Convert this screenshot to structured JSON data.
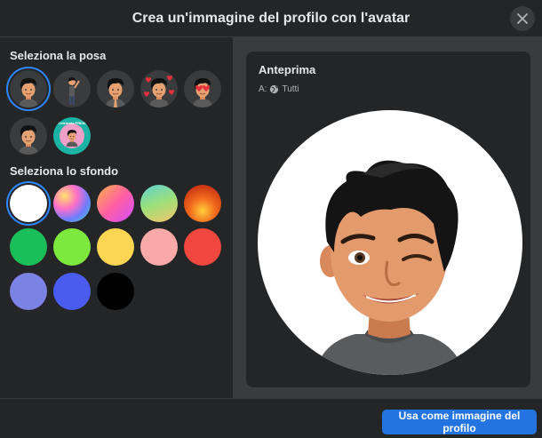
{
  "dialog": {
    "title": "Crea un'immagine del profilo con l'avatar",
    "close_icon": "close-icon"
  },
  "pose_section": {
    "title": "Seleziona la posa",
    "poses": [
      {
        "name": "avatar-headshot",
        "selected": true
      },
      {
        "name": "avatar-full-body-wave",
        "selected": false
      },
      {
        "name": "avatar-prayer-hands",
        "selected": false
      },
      {
        "name": "avatar-hearts",
        "selected": false
      },
      {
        "name": "avatar-heart-eyes",
        "selected": false
      },
      {
        "name": "avatar-thinking",
        "selected": false
      },
      {
        "name": "avatar-celebrate-badge",
        "selected": false
      }
    ],
    "celebrate_badge_text": "Celebrate PRIDE"
  },
  "background_section": {
    "title": "Seleziona lo sfondo",
    "swatches": [
      {
        "name": "white",
        "color": "#ffffff",
        "selected": true
      },
      {
        "name": "rainbow-sparkle",
        "color": "#b44dd6"
      },
      {
        "name": "pink-gradient",
        "color": "#f06aa8"
      },
      {
        "name": "teal-gradient",
        "color": "#6ec9b4"
      },
      {
        "name": "fire",
        "color": "#e8501a"
      },
      {
        "name": "green",
        "color": "#1bbf5a"
      },
      {
        "name": "lime",
        "color": "#7de83d"
      },
      {
        "name": "yellow",
        "color": "#fcd653"
      },
      {
        "name": "pink",
        "color": "#f9a9a8"
      },
      {
        "name": "red",
        "color": "#f0473f"
      },
      {
        "name": "periwinkle",
        "color": "#7b82e5"
      },
      {
        "name": "blue",
        "color": "#4a5cf0"
      },
      {
        "name": "black",
        "color": "#000000"
      }
    ]
  },
  "preview": {
    "title": "Anteprima",
    "audience_label": "A:",
    "audience_value": "Tutti",
    "audience_icon": "globe-icon"
  },
  "footer": {
    "primary_button": "Usa come immagine del profilo"
  },
  "colors": {
    "background": "#242526",
    "panel": "#3a3b3c",
    "accent": "#2374e1",
    "selection_ring": "#2d88ff"
  }
}
